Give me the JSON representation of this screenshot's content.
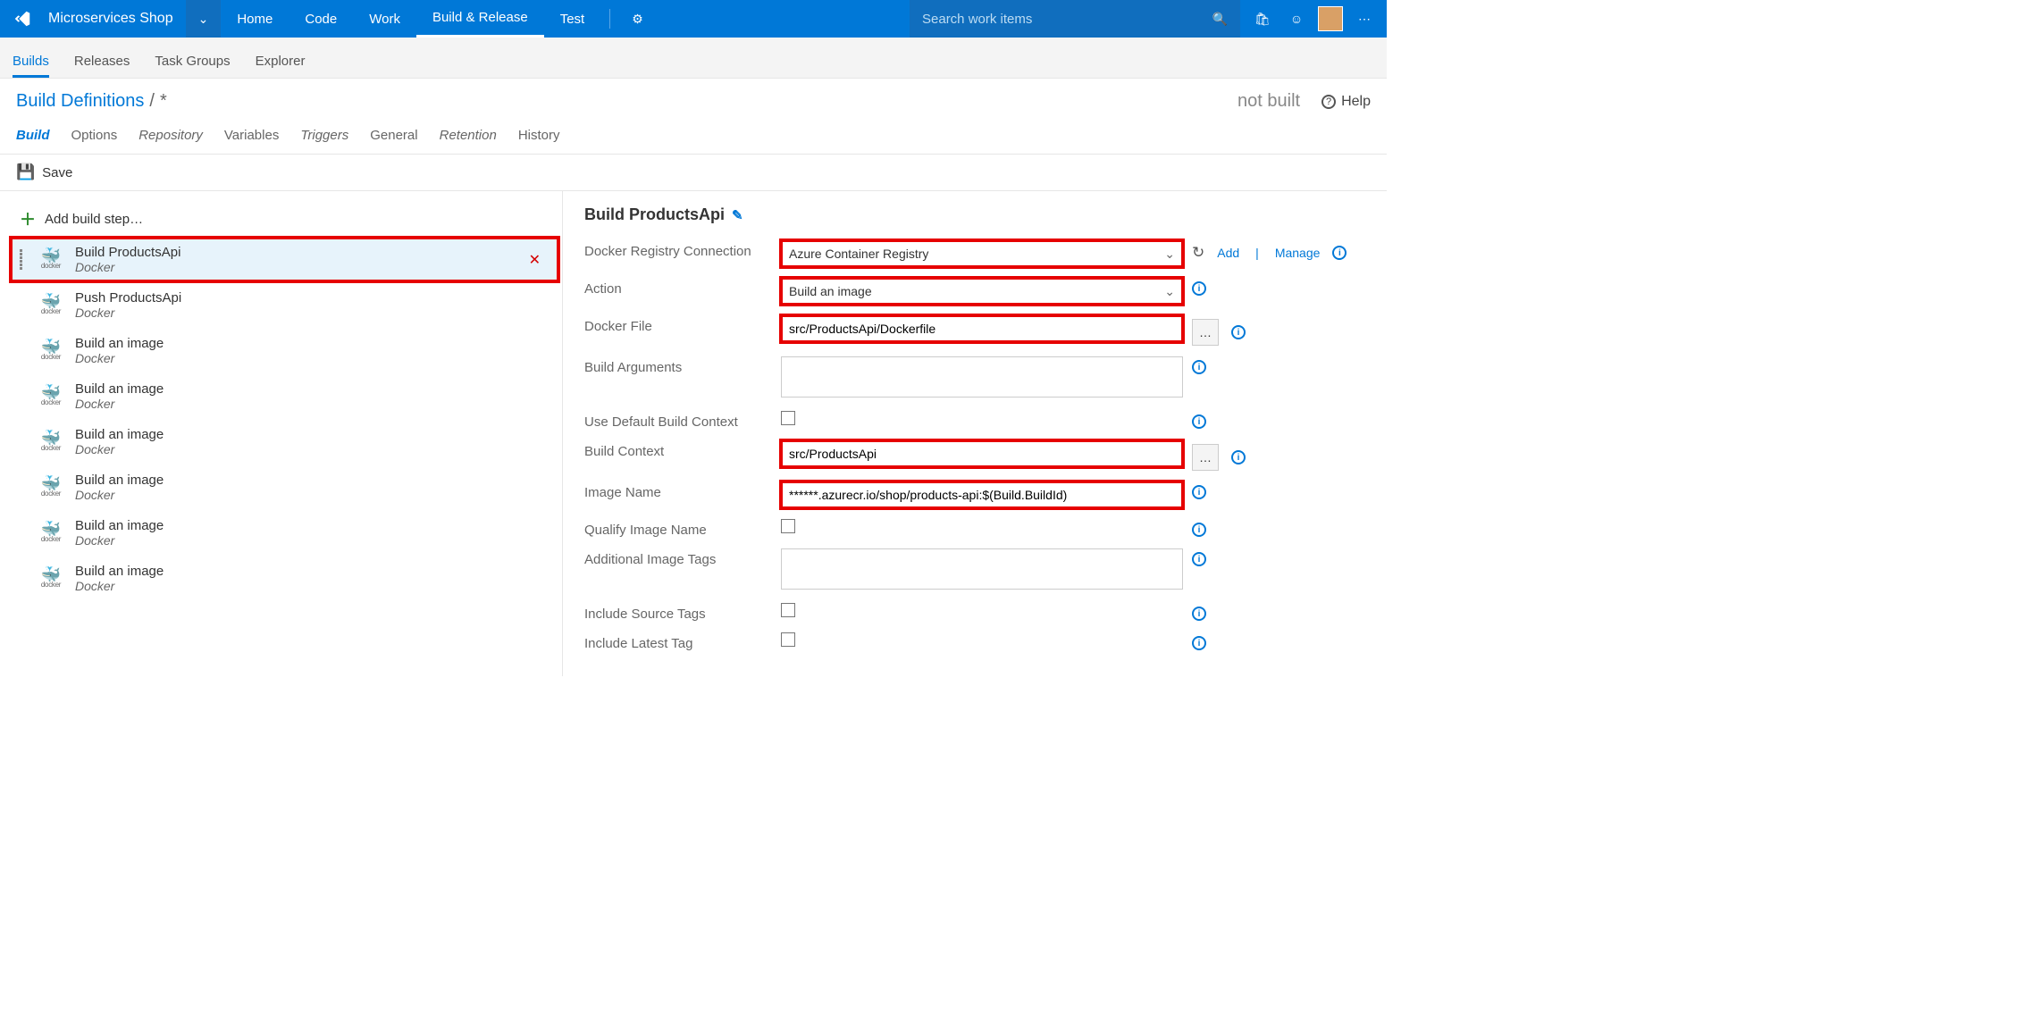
{
  "topbar": {
    "project": "Microservices Shop",
    "nav": [
      "Home",
      "Code",
      "Work",
      "Build & Release",
      "Test"
    ],
    "active_nav": "Build & Release",
    "search_placeholder": "Search work items"
  },
  "subnav": {
    "items": [
      "Builds",
      "Releases",
      "Task Groups",
      "Explorer"
    ],
    "active": "Builds"
  },
  "breadcrumb": {
    "link": "Build Definitions",
    "sep": "/",
    "star": "*",
    "status": "not built",
    "help": "Help"
  },
  "def_tabs": [
    "Build",
    "Options",
    "Repository",
    "Variables",
    "Triggers",
    "General",
    "Retention",
    "History"
  ],
  "save_label": "Save",
  "add_step_label": "Add build step…",
  "steps": [
    {
      "title": "Build ProductsApi",
      "sub": "Docker",
      "selected": true
    },
    {
      "title": "Push ProductsApi",
      "sub": "Docker"
    },
    {
      "title": "Build an image",
      "sub": "Docker"
    },
    {
      "title": "Build an image",
      "sub": "Docker"
    },
    {
      "title": "Build an image",
      "sub": "Docker"
    },
    {
      "title": "Build an image",
      "sub": "Docker"
    },
    {
      "title": "Build an image",
      "sub": "Docker"
    },
    {
      "title": "Build an image",
      "sub": "Docker"
    }
  ],
  "right": {
    "title": "Build ProductsApi",
    "fields": {
      "registry_label": "Docker Registry Connection",
      "registry_value": "Azure Container Registry",
      "action_label": "Action",
      "action_value": "Build an image",
      "dockerfile_label": "Docker File",
      "dockerfile_value": "src/ProductsApi/Dockerfile",
      "buildargs_label": "Build Arguments",
      "buildargs_value": "",
      "defaultctx_label": "Use Default Build Context",
      "buildctx_label": "Build Context",
      "buildctx_value": "src/ProductsApi",
      "imagename_label": "Image Name",
      "imagename_value": "******.azurecr.io/shop/products-api:$(Build.BuildId)",
      "qualify_label": "Qualify Image Name",
      "tags_label": "Additional Image Tags",
      "tags_value": "",
      "srctags_label": "Include Source Tags",
      "latest_label": "Include Latest Tag"
    },
    "links": {
      "add": "Add",
      "manage": "Manage"
    }
  }
}
